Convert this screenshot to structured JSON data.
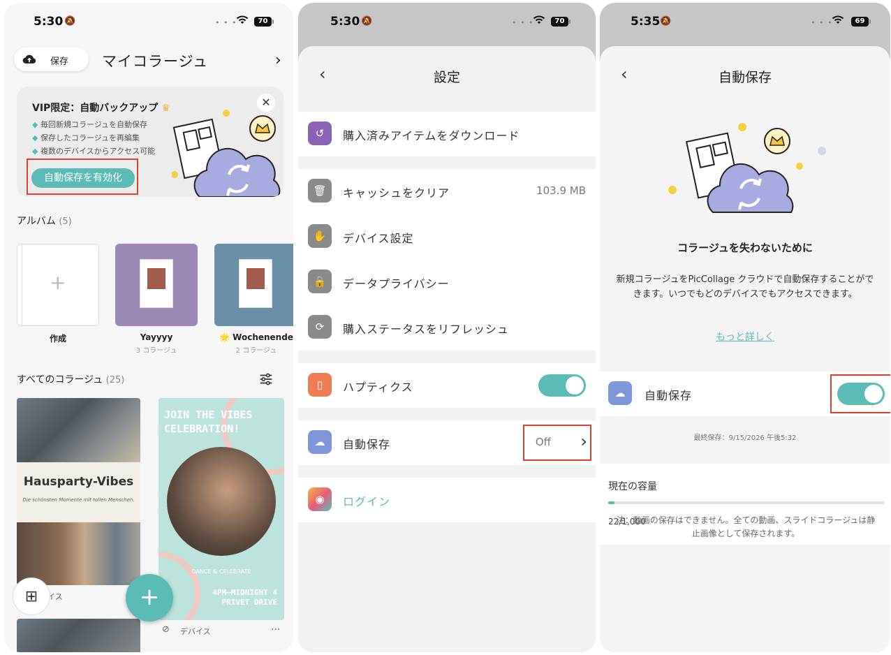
{
  "statusbar": {
    "p1": {
      "time": "5:30",
      "battery": "70"
    },
    "p2": {
      "time": "5:30",
      "battery": "70"
    },
    "p3": {
      "time": "5:35",
      "battery": "69"
    }
  },
  "screen1": {
    "save_button": "保存",
    "title": "マイコラージュ",
    "vip": {
      "title": "VIP限定：自動バックアップ",
      "features": [
        "毎回新規コラージュを自動保存",
        "保存したコラージュを再編集",
        "複数のデバイスからアクセス可能"
      ],
      "button": "自動保存を有効化"
    },
    "albums_label": "アルバム",
    "albums_count": "(5)",
    "albums": [
      {
        "name": "作成",
        "sub": ""
      },
      {
        "name": "Yayyyy",
        "sub": "3 コラージュ"
      },
      {
        "name": "🌟 Wochenende",
        "sub": "2 コラージュ"
      }
    ],
    "all_label": "すべてのコラージュ",
    "all_count": "(25)",
    "collage1": {
      "title": "Hausparty-Vibes",
      "subtitle": "Die schönsten Momente mit tollen Menschen.",
      "meta": "イス"
    },
    "collage2": {
      "header": "JOIN THE VIBES CELEBRATION!",
      "dance": "DANCE & CELEBRATE",
      "time": "4PM–MIDNIGHT 4 PRIVET DRIVE",
      "meta": "デバイス",
      "more": "···"
    }
  },
  "screen2": {
    "title": "設定",
    "rows": {
      "download": "購入済みアイテムをダウンロード",
      "cache": "キャッシュをクリア",
      "cache_size": "103.9 MB",
      "device": "デバイス設定",
      "privacy": "データプライバシー",
      "refresh": "購入ステータスをリフレッシュ",
      "haptics": "ハプティクス",
      "autosave": "自動保存",
      "autosave_value": "Off",
      "login": "ログイン"
    },
    "haptics_on": true
  },
  "screen3": {
    "title": "自動保存",
    "heading": "コラージュを失わないために",
    "description": "新規コラージュをPicCollage クラウドで自動保存することができます。いつでもどのデバイスでもアクセスできます。",
    "link": "もっと詳しく",
    "autosave_label": "自動保存",
    "autosave_on": true,
    "last_saved": "最終保存：9/15/2026 午後5:32",
    "capacity_label": "現在の容量",
    "capacity_value": "22/1,000",
    "capacity_fraction": 0.022,
    "note": "注：動画の保存はできません。全ての動画、スライドコラージュは静止画像として保存されます。"
  },
  "colors": {
    "accent": "#5bbcb7",
    "highlight": "#e03f2c"
  }
}
